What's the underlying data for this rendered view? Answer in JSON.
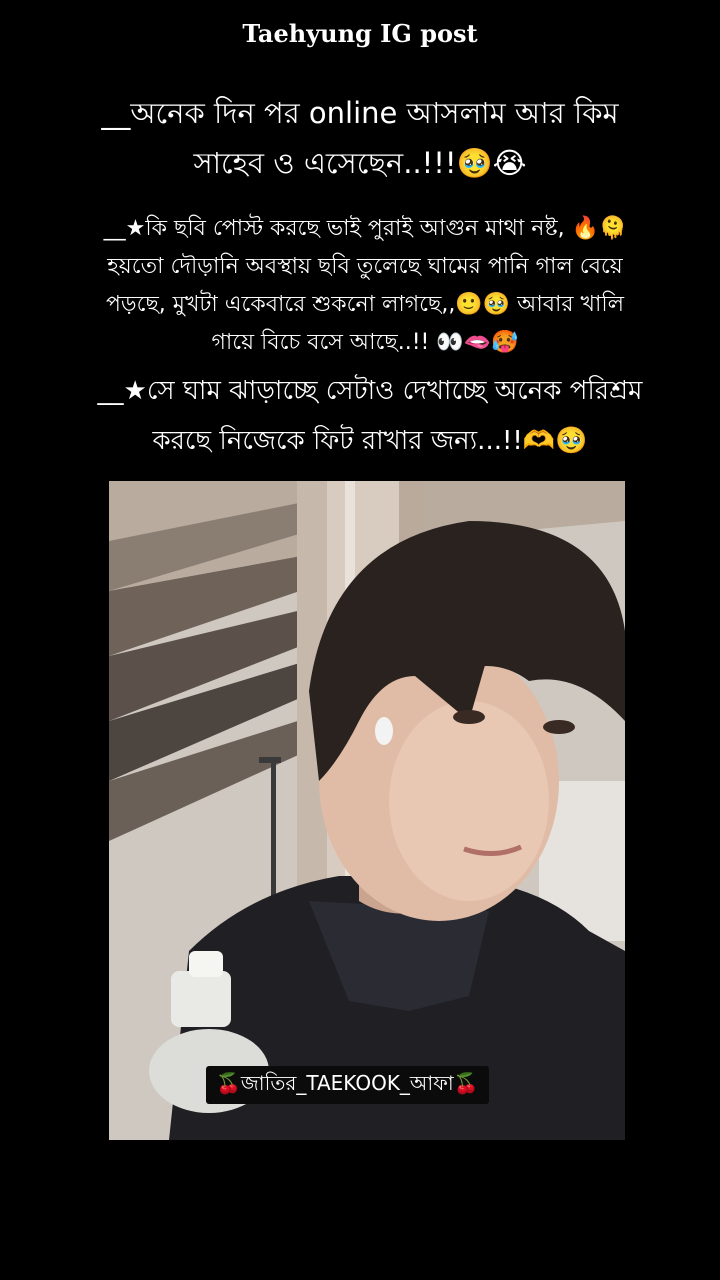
{
  "header": {
    "title": "Taehyung IG post"
  },
  "captions": [
    "__অনেক দিন পর online আসলাম আর কিম\nসাহেব ও এসেছেন..!!!🥹😭",
    "__★কি ছবি পোস্ট করছে ভাই পুরাই  আগুন মাথা নষ্ট, 🔥🫠\nহয়তো দৌড়ানি অবস্থায় ছবি তুলেছে ঘামের পানি গাল বেয়ে\nপড়ছে,  মুখটা একেবারে শুকনো লাগছে,,🙂🥹 আবার খালি\nগায়ে বিচে বসে আছে..!! 👀🫦🥵",
    "__★সে ঘাম ঝাড়াচ্ছে সেটাও দেখাচ্ছে অনেক পরিশ্রম\nকরছে নিজেকে ফিট রাখার জন্য...!!🫶🥹"
  ],
  "photo": {
    "watermark": "🍒জাতির_TAEKOOK_আফা🍒"
  },
  "colors": {
    "background": "#000000",
    "text": "#ffffff"
  }
}
